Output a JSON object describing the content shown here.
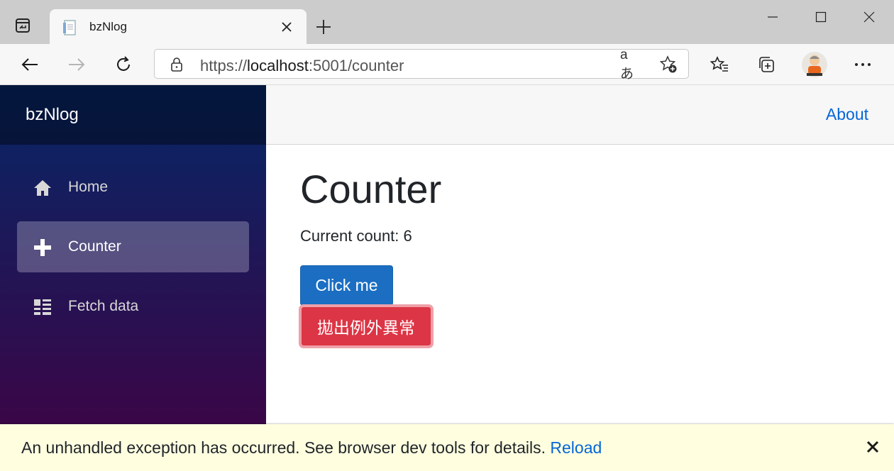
{
  "browser": {
    "tab": {
      "title": "bzNlog",
      "favicon": "page-icon"
    },
    "address": {
      "scheme": "https://",
      "host": "localhost",
      "port_path": ":5001/counter",
      "read_aloud_glyph": "aあ"
    },
    "icons": {
      "tab_actions": "tab-actions-icon",
      "close_tab": "close-icon",
      "new_tab": "plus-icon",
      "minimize": "minimize-icon",
      "maximize": "maximize-icon",
      "close_window": "close-icon",
      "back": "arrow-left-icon",
      "forward": "arrow-right-icon",
      "refresh": "refresh-icon",
      "lock": "lock-icon",
      "favorite": "star-add-icon",
      "favorites": "favorites-icon",
      "collections": "collections-icon",
      "profile": "avatar",
      "more": "more-icon"
    }
  },
  "app": {
    "brand": "bzNlog",
    "nav": [
      {
        "label": "Home",
        "icon": "home-icon",
        "active": false
      },
      {
        "label": "Counter",
        "icon": "plus-icon",
        "active": true
      },
      {
        "label": "Fetch data",
        "icon": "list-icon",
        "active": false
      }
    ],
    "top_link": "About",
    "page": {
      "title": "Counter",
      "count_label": "Current count: 6",
      "click_button": "Click me",
      "throw_button": "拋出例外異常"
    },
    "error_ui": {
      "message": "An unhandled exception has occurred. See browser dev tools for details.",
      "reload": "Reload",
      "dismiss": "✕"
    },
    "colors": {
      "primary": "#1b6ec2",
      "danger": "#dc3545",
      "link": "#0366d6",
      "sidebar_top": "#052767",
      "sidebar_bottom": "#3a0647",
      "error_bg": "#ffffe0"
    }
  }
}
